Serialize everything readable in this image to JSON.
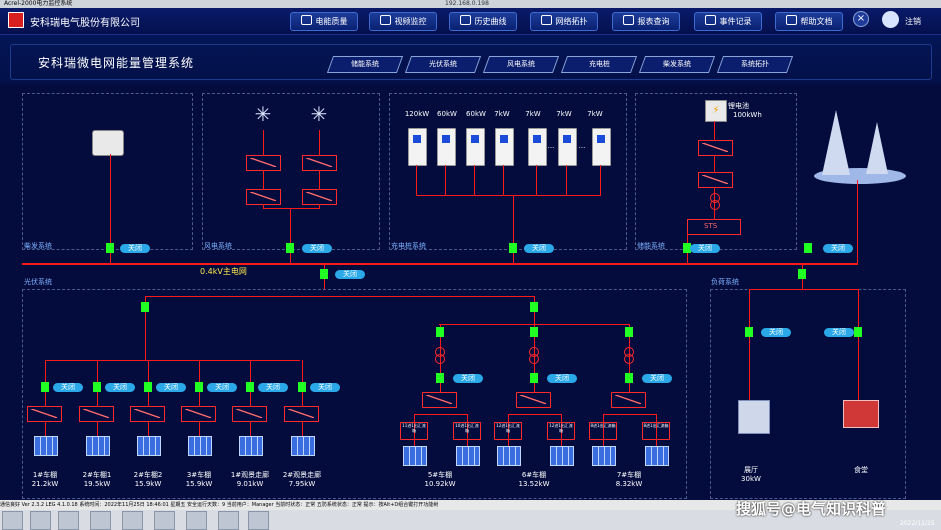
{
  "window": {
    "title": "Acrel-2000电力监控系统",
    "ip": "192.168.0.198",
    "close_label": "×"
  },
  "header": {
    "company": "安科瑞电气股份有限公司",
    "user_label": "注销",
    "nav": [
      "电能质量",
      "视频监控",
      "历史曲线",
      "网络拓扑",
      "报表查询",
      "事件记录",
      "帮助文档"
    ]
  },
  "banner": {
    "title": "安科瑞微电网能量管理系统",
    "tabs": [
      "储能系统",
      "光伏系统",
      "风电系统",
      "充电桩",
      "柴发系统",
      "系统拓扑"
    ]
  },
  "sections": {
    "diesel": "柴发系统",
    "wind": "风电系统",
    "charging": "充电桩系统",
    "storage": "储能系统",
    "pv": "光伏系统",
    "load": "负荷系统"
  },
  "bus_label": "0.4kV主电网",
  "switch_state": "关闭",
  "charging": {
    "ratings": [
      "120kW",
      "60kW",
      "60kW",
      "7kW",
      "7kW",
      "7kW",
      "7kW"
    ],
    "dots": "..."
  },
  "storage": {
    "battery": "锂电池",
    "capacity": "100kWh",
    "sts": "STS"
  },
  "pv_arrays": [
    {
      "name": "1#车棚",
      "power": "21.2kW"
    },
    {
      "name": "2#车棚1",
      "power": "19.5kW"
    },
    {
      "name": "2#车棚2",
      "power": "15.9kW"
    },
    {
      "name": "3#车棚",
      "power": "15.9kW"
    },
    {
      "name": "1#观景走廊",
      "power": "9.01kW"
    },
    {
      "name": "2#观景走廊",
      "power": "7.95kW"
    }
  ],
  "pv_groups": [
    {
      "name": "5#车棚",
      "power": "10.92kW",
      "boxes": [
        "11进1出汇流箱",
        "10进1出汇流箱"
      ]
    },
    {
      "name": "6#车棚",
      "power": "13.52kW",
      "boxes": [
        "12进1出汇流箱",
        "12进1出汇流箱"
      ]
    },
    {
      "name": "7#车棚",
      "power": "8.32kW",
      "boxes": [
        "8进1出汇流箱",
        "8进1出汇流箱"
      ]
    }
  ],
  "loads": [
    {
      "name": "展厅",
      "power": "30kW"
    },
    {
      "name": "食堂",
      "power": ""
    }
  ],
  "status": {
    "text": "通信良好   Ver 2.3.2 LEG 4.1.0.18   系统时间：2022年11月25日 18:46:01   星期五   安全运行天数：9   当前用户：Manager   当前时状态：正常   五防系统状态：正常   提示：按Alt+D组合键打开功能树"
  },
  "watermark": "搜狐号@电气知识科普",
  "clock": {
    "date": "2022/11/25"
  }
}
